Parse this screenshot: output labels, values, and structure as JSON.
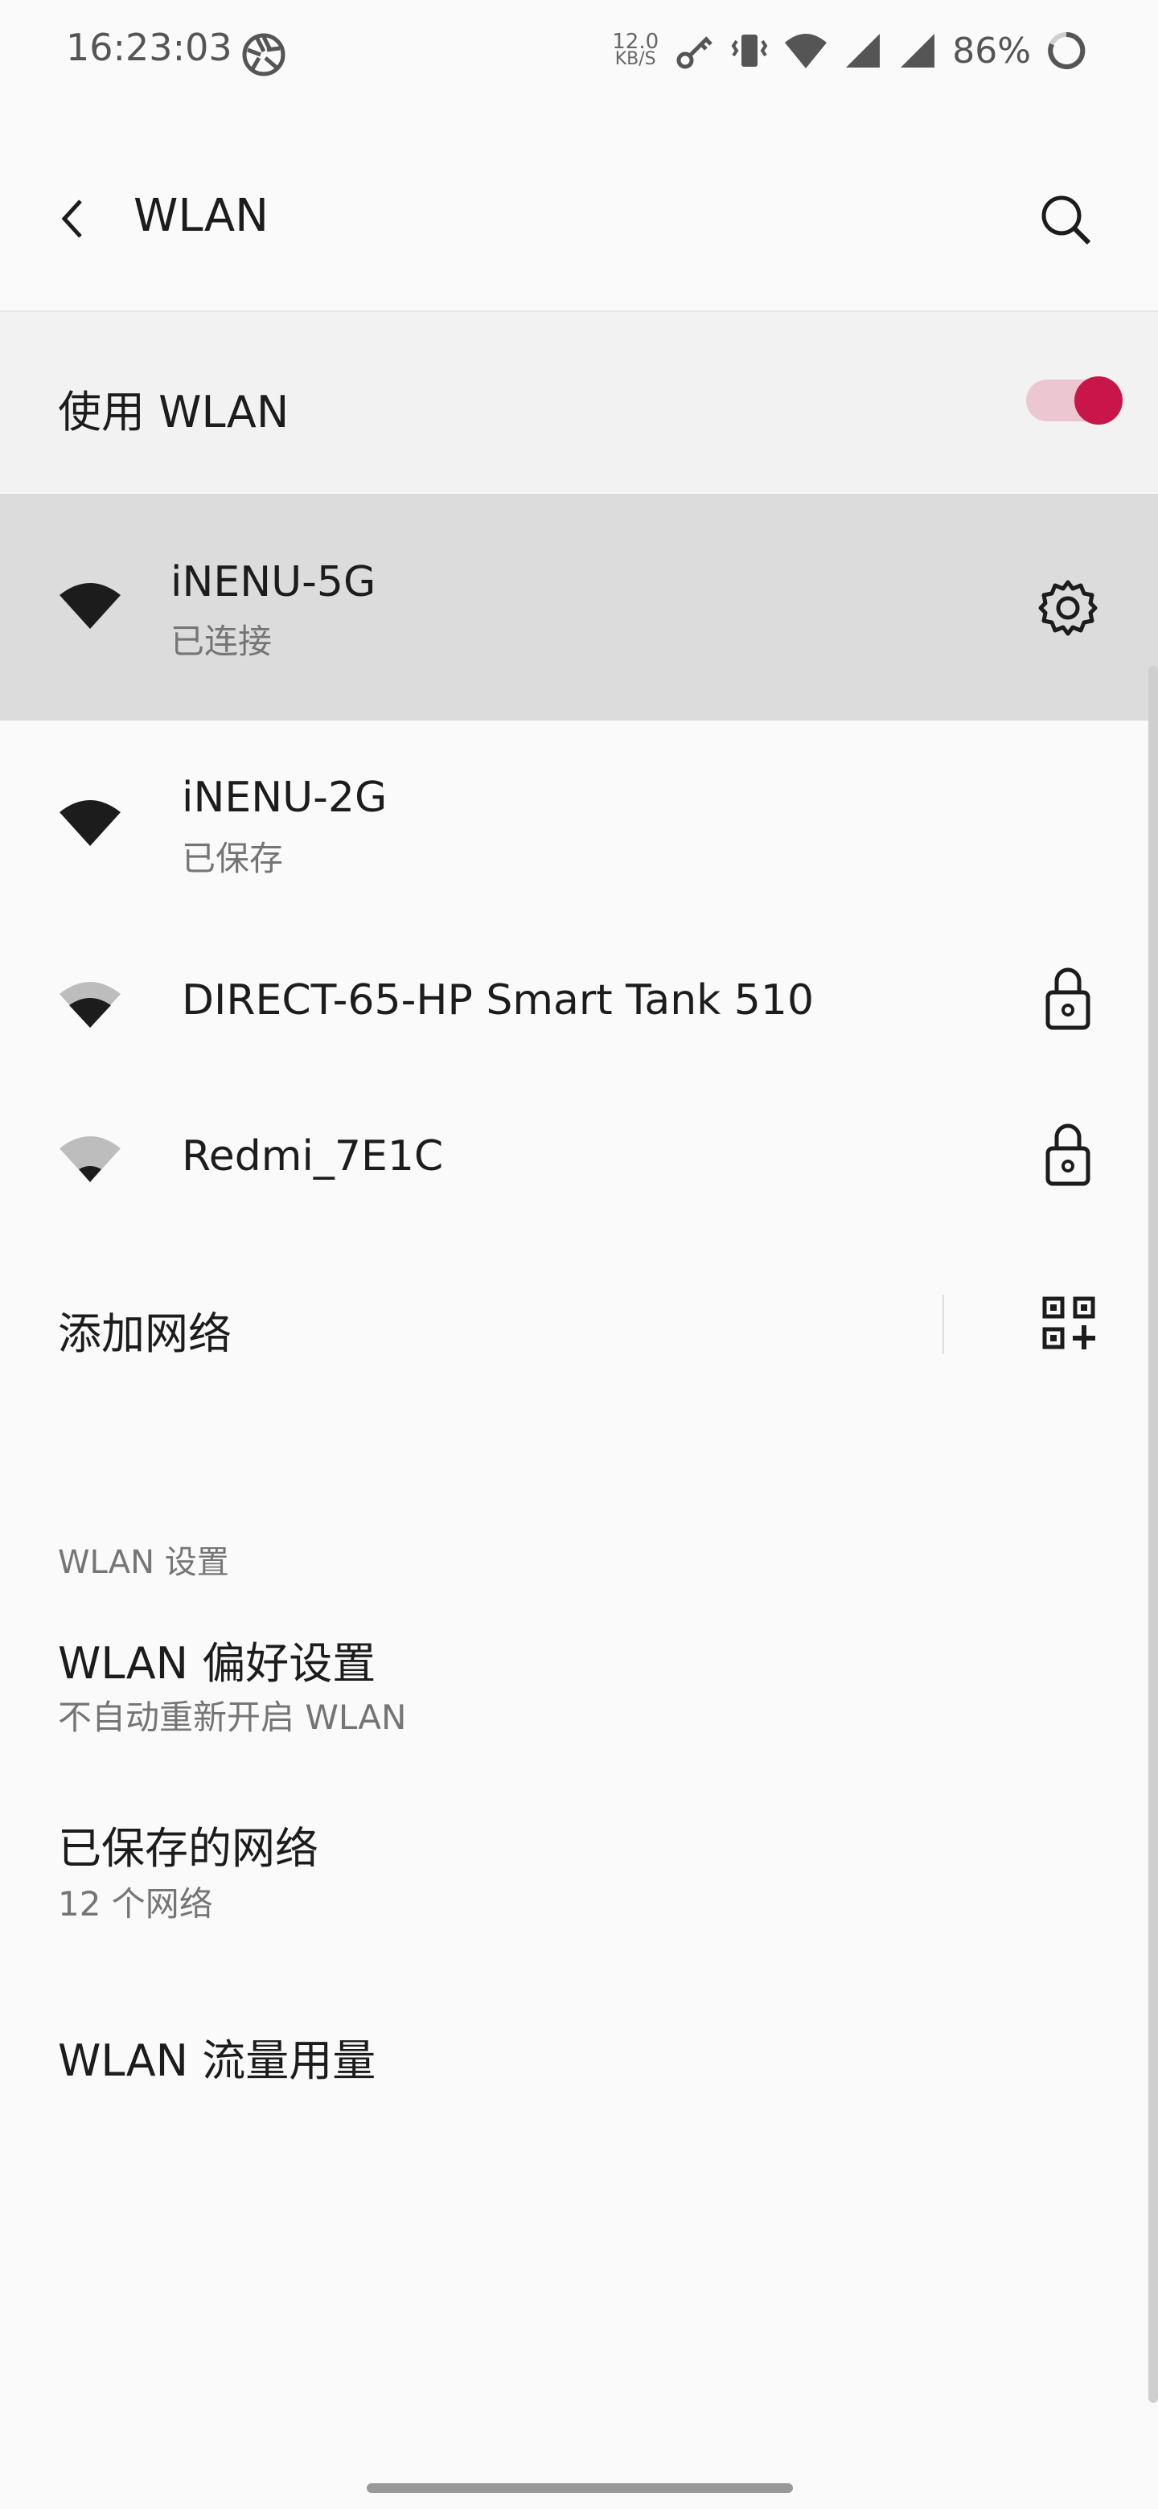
{
  "status_bar": {
    "time": "16:23:03",
    "net_speed_value": "12.0",
    "net_speed_unit": "KB/S",
    "battery": "86%",
    "icons": [
      "aperture-icon",
      "key-icon",
      "vibrate-icon",
      "wifi-icon",
      "signal-icon",
      "signal-icon",
      "battery-ring-icon"
    ]
  },
  "header": {
    "title": "WLAN",
    "back_icon": "back-arrow-icon",
    "search_icon": "search-icon"
  },
  "wlan_toggle": {
    "label": "使用 WLAN",
    "on": true,
    "accent_color": "#c8164a"
  },
  "networks": [
    {
      "name": "iNENU-5G",
      "status": "已连接",
      "signal": "full",
      "action_icon": "gear-icon"
    },
    {
      "name": "iNENU-2G",
      "status": "已保存",
      "signal": "full"
    },
    {
      "name": "DIRECT-65-HP Smart Tank 510",
      "signal": "medium",
      "action_icon": "lock-icon"
    },
    {
      "name": "Redmi_7E1C",
      "signal": "weak",
      "action_icon": "lock-icon"
    }
  ],
  "add_network": {
    "label": "添加网络",
    "icon": "qr-code-add-icon"
  },
  "settings": {
    "section_title": "WLAN 设置",
    "items": [
      {
        "title": "WLAN 偏好设置",
        "subtitle": "不自动重新开启 WLAN"
      },
      {
        "title": "已保存的网络",
        "subtitle": "12 个网络"
      },
      {
        "title": "WLAN 流量用量"
      }
    ]
  }
}
